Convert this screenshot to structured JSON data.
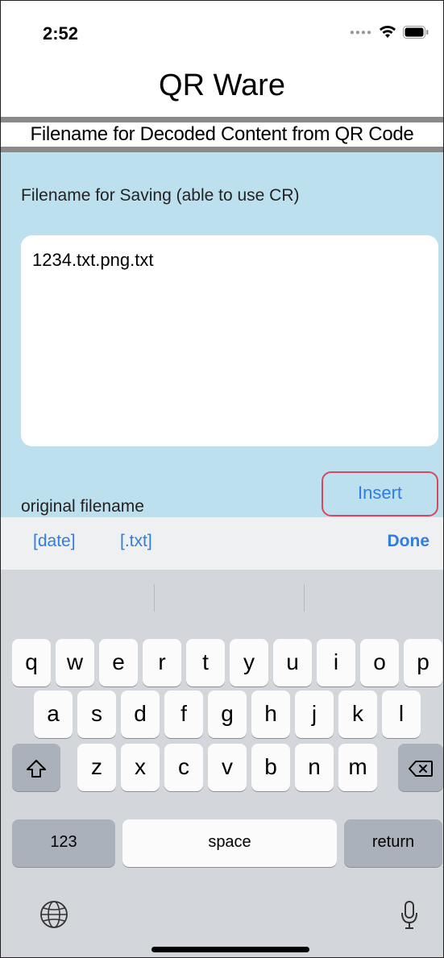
{
  "status_bar": {
    "time": "2:52"
  },
  "nav": {
    "title": "QR Ware"
  },
  "subheader": {
    "text": "Filename for Decoded Content from QR Code"
  },
  "form": {
    "section_label": "Filename for Saving (able to use CR)",
    "filename_value": "1234.txt.png.txt",
    "original_filename_label": "original filename",
    "insert_label": "Insert"
  },
  "accessory": {
    "date_label": "[date]",
    "txt_label": "[.txt]",
    "done_label": "Done"
  },
  "keyboard": {
    "row1": [
      "q",
      "w",
      "e",
      "r",
      "t",
      "y",
      "u",
      "i",
      "o",
      "p"
    ],
    "row2": [
      "a",
      "s",
      "d",
      "f",
      "g",
      "h",
      "j",
      "k",
      "l"
    ],
    "row3": [
      "z",
      "x",
      "c",
      "v",
      "b",
      "n",
      "m"
    ],
    "numbers_label": "123",
    "space_label": "space",
    "return_label": "return",
    "shift_icon": "shift-icon",
    "delete_icon": "delete-icon",
    "globe_icon": "globe-icon",
    "mic_icon": "microphone-icon"
  },
  "colors": {
    "accent_blue": "#2f7de1",
    "content_bg": "#bde0ee",
    "insert_border": "#d9475f",
    "separator": "#8a8a8a"
  }
}
